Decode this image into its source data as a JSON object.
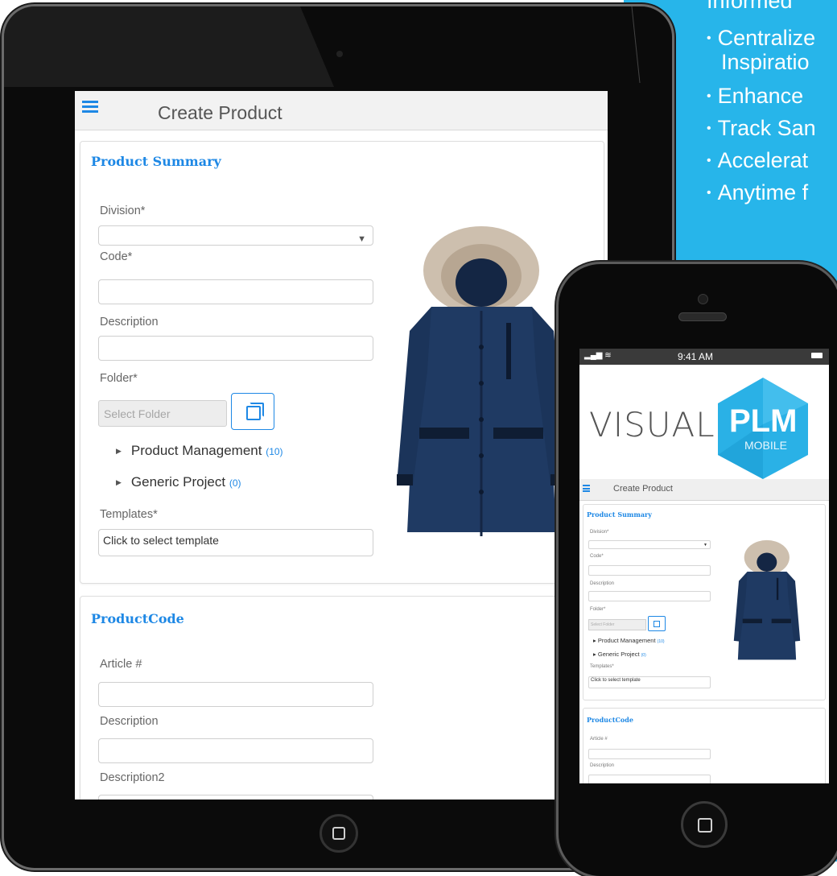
{
  "marketing": {
    "bullets": [
      {
        "text": "Informed"
      },
      {
        "text": "Centralize"
      },
      {
        "text": "Inspiratio"
      },
      {
        "text": "Enhance"
      },
      {
        "text": "Track San"
      },
      {
        "text": "Accelerat"
      },
      {
        "text": "Anytime f"
      }
    ]
  },
  "tablet": {
    "header": {
      "title": "Create Product"
    },
    "summary": {
      "title": "Product Summary",
      "division_label": "Division*",
      "division_value": "",
      "code_label": "Code*",
      "description_label": "Description",
      "folder_label": "Folder*",
      "folder_placeholder": "Select Folder",
      "tree": [
        {
          "label": "Product Management",
          "count": "(10)"
        },
        {
          "label": "Generic Project",
          "count": "(0)"
        }
      ],
      "templates_label": "Templates*",
      "templates_value": "Click to select template"
    },
    "product_code": {
      "title": "ProductCode",
      "article_label": "Article #",
      "description_label": "Description",
      "description2_label": "Description2"
    }
  },
  "phone": {
    "status": {
      "time": "9:41 AM"
    },
    "logo": {
      "visual": "VISUAL",
      "plm": "PLM",
      "mobile": "MOBILE"
    },
    "header": {
      "title": "Create Product"
    },
    "summary": {
      "title": "Product Summary",
      "division_label": "Division*",
      "code_label": "Code*",
      "description_label": "Description",
      "folder_label": "Folder*",
      "folder_placeholder": "Select Folder",
      "tree": [
        {
          "label": "Product Management",
          "count": "(10)"
        },
        {
          "label": "Generic Project",
          "count": "(0)"
        }
      ],
      "templates_label": "Templates*",
      "templates_value": "Click to select template"
    },
    "product_code": {
      "title": "ProductCode",
      "article_label": "Article #",
      "description_label": "Description"
    }
  },
  "colors": {
    "accent": "#1e88e5",
    "panel": "#27b5ea",
    "jacket": "#1f3a63"
  }
}
